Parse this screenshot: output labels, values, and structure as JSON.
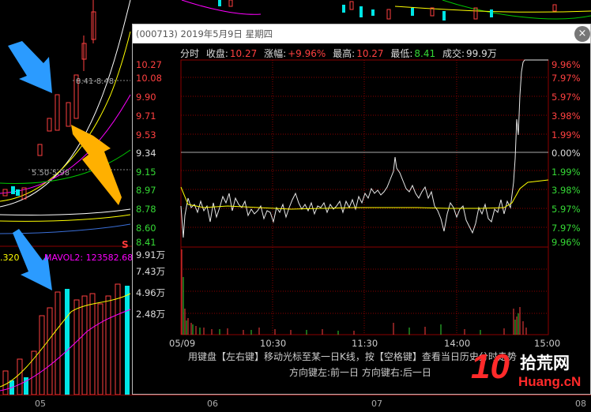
{
  "background": {
    "mavol_values": [
      ".320",
      "MAVOL2: 123582.680"
    ],
    "mini_labels": [
      "8.41-8.48",
      "5.50-5.98"
    ],
    "s_marker": "S",
    "date_axis": [
      "05",
      "06",
      "07",
      "08"
    ]
  },
  "popup": {
    "title": "(000713) 2019年5月9日 星期四",
    "close_icon": "×",
    "info": {
      "label_time": "分时",
      "label_close": "收盘:",
      "close": "10.27",
      "label_change": "涨幅:",
      "change": "+9.96%",
      "label_high": "最高:",
      "high": "10.27",
      "label_low": "最低:",
      "low": "8.41",
      "label_volume": "成交:",
      "volume": "99.9万"
    },
    "price_axis": [
      "10.27",
      "10.08",
      "9.90",
      "9.71",
      "9.53",
      "9.34",
      "9.15",
      "8.97",
      "8.78",
      "8.60",
      "8.41"
    ],
    "pct_axis": [
      "9.96%",
      "7.97%",
      "5.97%",
      "3.98%",
      "1.99%",
      "0.00%",
      "1.99%",
      "3.98%",
      "5.97%",
      "7.97%",
      "9.96%"
    ],
    "volume_axis": [
      "9.91万",
      "7.43万",
      "4.96万",
      "2.48万"
    ],
    "time_axis": [
      "05/09",
      "10:30",
      "11:30",
      "14:00",
      "15:00"
    ],
    "hint_line1": "用键盘【左右键】移动光标至某一日K线，按【空格键】查看当日历史分时走势",
    "hint_line2": "方向键左:前一日   方向键右:后一日"
  },
  "watermark": {
    "digits": "10",
    "cn": "拾荒网",
    "en": "Huang.cN"
  },
  "colors": {
    "up": "#ff4040",
    "down": "#35d935",
    "avg_line": "#ffff00",
    "arrow_blue": "#2b9bff",
    "arrow_orange": "#ffb000"
  }
}
